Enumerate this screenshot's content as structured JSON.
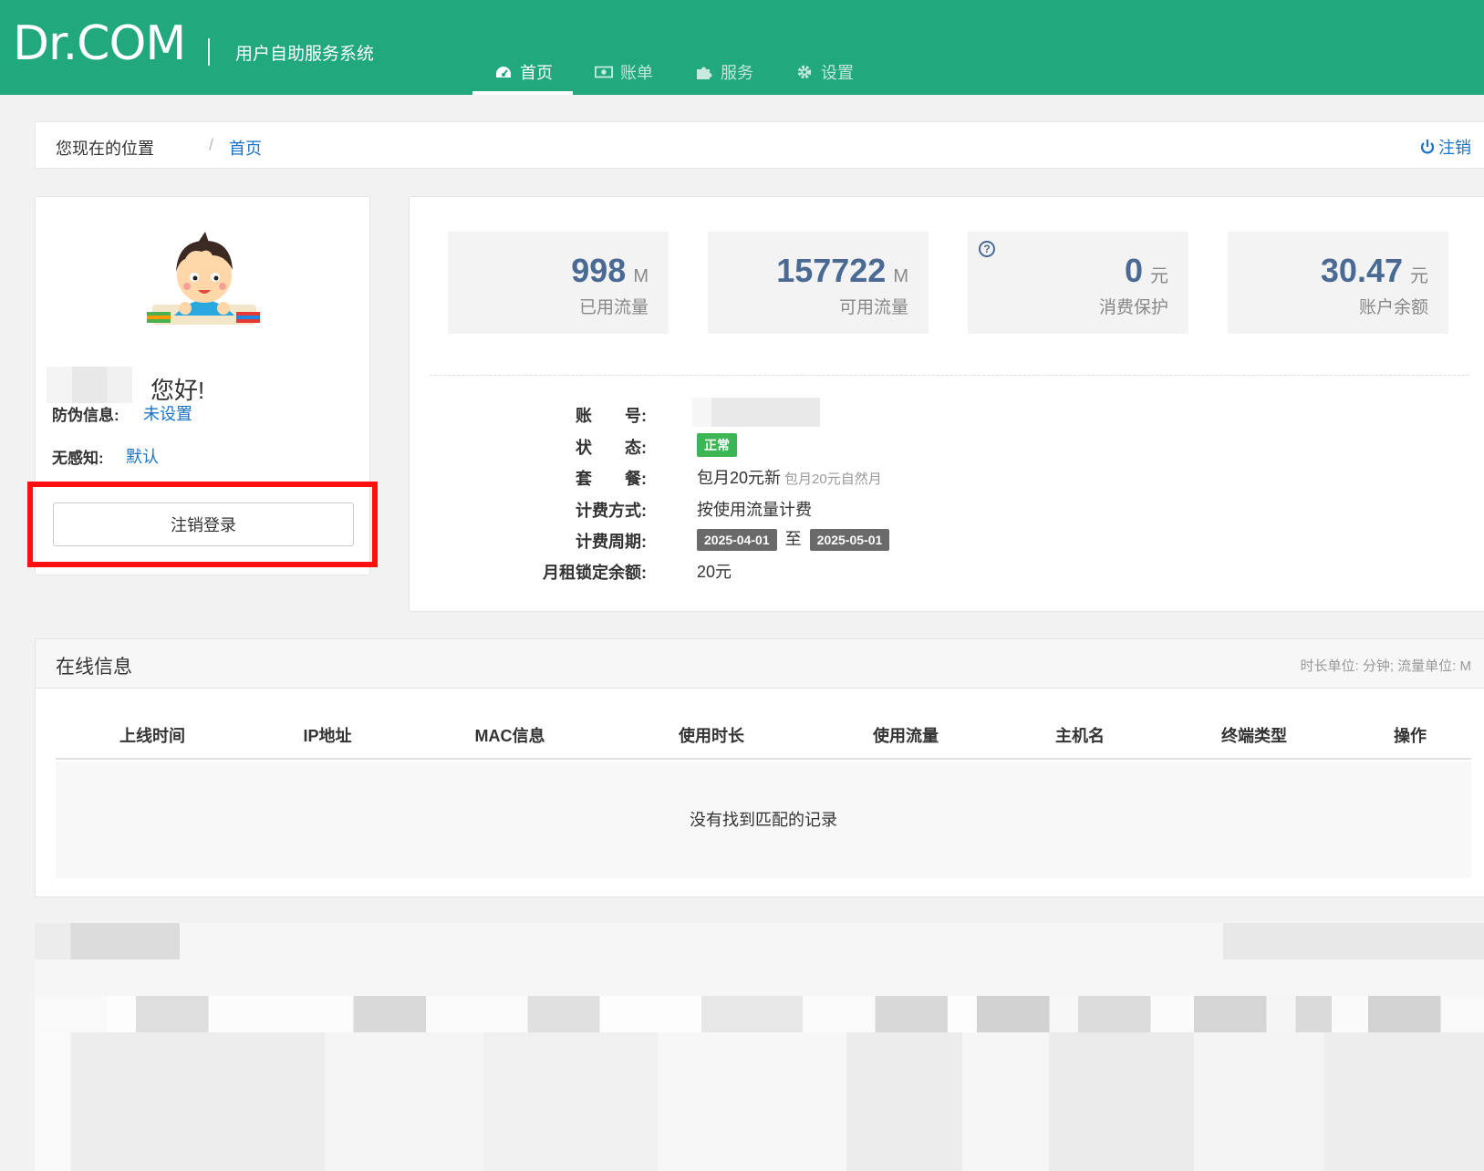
{
  "header": {
    "logo": "Dr.COM",
    "system_name": "用户自助服务系统",
    "nav": [
      {
        "label": "首页",
        "icon": "dashboard-icon",
        "active": true
      },
      {
        "label": "账单",
        "icon": "money-icon",
        "active": false
      },
      {
        "label": "服务",
        "icon": "puzzle-icon",
        "active": false
      },
      {
        "label": "设置",
        "icon": "gear-icon",
        "active": false
      }
    ]
  },
  "breadcrumb": {
    "prefix": "您现在的位置",
    "separator": "/",
    "current": "首页",
    "logout": "注销"
  },
  "profile": {
    "greeting": "您好!",
    "anti_fraud_label": "防伪信息:",
    "anti_fraud_value": "未设置",
    "seamless_label": "无感知:",
    "seamless_value": "默认",
    "logout_button": "注销登录"
  },
  "stats": [
    {
      "value": "998",
      "unit": "M",
      "label": "已用流量"
    },
    {
      "value": "157722",
      "unit": "M",
      "label": "可用流量"
    },
    {
      "value": "0",
      "unit": "元",
      "label": "消费保护",
      "help": "?"
    },
    {
      "value": "30.47",
      "unit": "元",
      "label": "账户余额"
    }
  ],
  "account": {
    "account_label": "账　　号:",
    "status_label": "状　　态:",
    "status_value": "正常",
    "package_label": "套　　餐:",
    "package_value": "包月20元新",
    "package_note": "包月20元自然月",
    "billing_label": "计费方式:",
    "billing_value": "按使用流量计费",
    "period_label": "计费周期:",
    "period_start": "2025-04-01",
    "period_to": "至",
    "period_end": "2025-05-01",
    "locked_label": "月租锁定余额:",
    "locked_value": "20元"
  },
  "online": {
    "title": "在线信息",
    "note": "时长单位: 分钟; 流量单位: M",
    "columns": [
      "上线时间",
      "IP地址",
      "MAC信息",
      "使用时长",
      "使用流量",
      "主机名",
      "终端类型",
      "操作"
    ],
    "empty": "没有找到匹配的记录"
  },
  "colors": {
    "brand": "#21a87c",
    "link": "#1a73c9",
    "stat_value": "#4a6a93",
    "ok": "#3cb654",
    "highlight": "#ff1010"
  }
}
